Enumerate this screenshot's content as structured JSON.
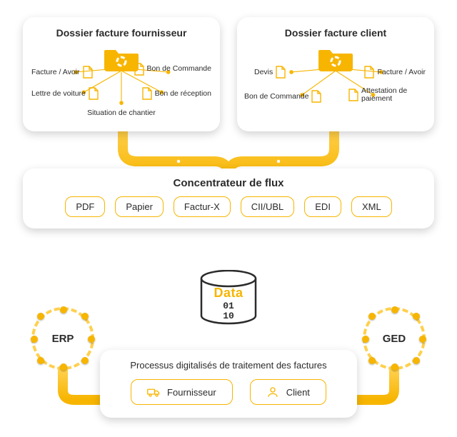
{
  "colors": {
    "accent": "#F7B500",
    "accent_light": "#FFD04D",
    "text": "#2b2b2b"
  },
  "top": {
    "supplier": {
      "title": "Dossier facture fournisseur",
      "items": {
        "facture_avoir": "Facture / Avoir",
        "bon_commande": "Bon de Commande",
        "lettre_voiture": "Lettre de voiture",
        "bon_reception": "Bon de réception",
        "situation_chantier": "Situation de chantier"
      }
    },
    "client": {
      "title": "Dossier facture client",
      "items": {
        "devis": "Devis",
        "facture_avoir": "Facture / Avoir",
        "bon_commande": "Bon de Commande",
        "attestation_paiement": "Attestation de paiement"
      }
    }
  },
  "hub": {
    "title": "Concentrateur de flux",
    "formats": [
      "PDF",
      "Papier",
      "Factur-X",
      "CII/UBL",
      "EDI",
      "XML"
    ]
  },
  "data": {
    "label": "Data",
    "bin_top": "01",
    "bin_bottom": "10"
  },
  "bottom": {
    "title": "Processus digitalisés de traitement des factures",
    "buttons": {
      "supplier": "Fournisseur",
      "client": "Client"
    }
  },
  "side": {
    "left": "ERP",
    "right": "GED"
  },
  "icons": {
    "folder": "folder-icon",
    "document": "document-icon",
    "truck": "truck-icon",
    "user": "user-icon",
    "cylinder": "database-icon"
  }
}
